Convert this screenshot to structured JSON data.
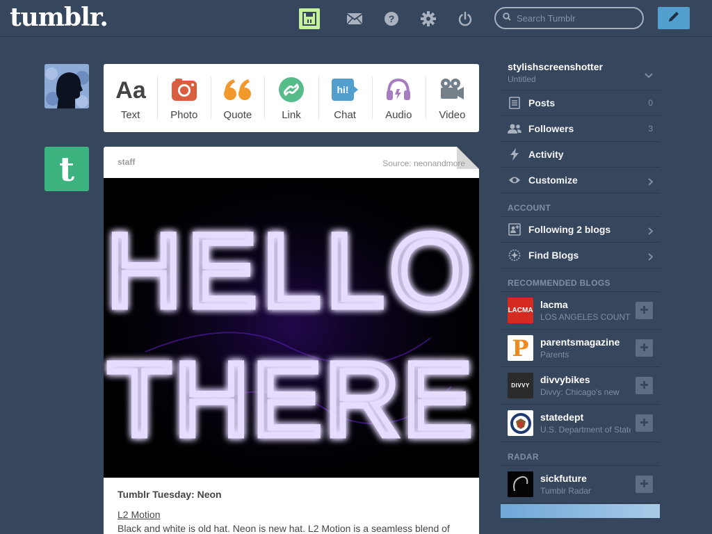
{
  "header": {
    "logo": "tumblr.",
    "search_placeholder": "Search Tumblr"
  },
  "post_types": [
    {
      "label": "Text",
      "icon": "text-icon",
      "color": "#444444"
    },
    {
      "label": "Photo",
      "icon": "camera-icon",
      "color": "#d95e40"
    },
    {
      "label": "Quote",
      "icon": "quote-icon",
      "color": "#f2992e"
    },
    {
      "label": "Link",
      "icon": "link-icon",
      "color": "#56bc8a"
    },
    {
      "label": "Chat",
      "icon": "chat-icon",
      "color": "#529ecc"
    },
    {
      "label": "Audio",
      "icon": "headphones-icon",
      "color": "#a77dc2"
    },
    {
      "label": "Video",
      "icon": "video-camera-icon",
      "color": "#748089"
    }
  ],
  "post": {
    "author": "staff",
    "source": "Source: neonandmore",
    "image_text_line1": "HELLO",
    "image_text_line2": "THERE",
    "title": "Tumblr Tuesday: Neon",
    "link": "L2 Motion",
    "body": "Black and white is old hat. Neon is new hat. L2 Motion is a seamless blend of"
  },
  "sidebar": {
    "blog_name": "stylishscreenshotter",
    "blog_subtitle": "Untitled",
    "menu": [
      {
        "label": "Posts",
        "count": "0",
        "icon": "posts-icon"
      },
      {
        "label": "Followers",
        "count": "3",
        "icon": "followers-icon"
      },
      {
        "label": "Activity",
        "count": "",
        "icon": "lightning-icon"
      },
      {
        "label": "Customize",
        "count": "",
        "icon": "eye-icon"
      }
    ],
    "account_heading": "ACCOUNT",
    "account_items": [
      {
        "label": "Following 2 blogs",
        "icon": "following-icon"
      },
      {
        "label": "Find Blogs",
        "icon": "compass-icon"
      }
    ],
    "recommended_heading": "RECOMMENDED BLOGS",
    "recommended": [
      {
        "name": "lacma",
        "desc": "LOS ANGELES COUNTY",
        "thumb_text": "LACMA",
        "thumb_color": "#d42a20"
      },
      {
        "name": "parentsmagazine",
        "desc": "Parents",
        "thumb_text": "P",
        "thumb_color": "#ffffff"
      },
      {
        "name": "divvybikes",
        "desc": "Divvy: Chicago's new",
        "thumb_text": "DIVVY",
        "thumb_color": "#2b2b2b"
      },
      {
        "name": "statedept",
        "desc": "U.S. Department of State",
        "thumb_text": "",
        "thumb_color": "#ffffff"
      }
    ],
    "radar_heading": "RADAR",
    "radar": {
      "name": "sickfuture",
      "desc": "Tumblr Radar"
    }
  }
}
